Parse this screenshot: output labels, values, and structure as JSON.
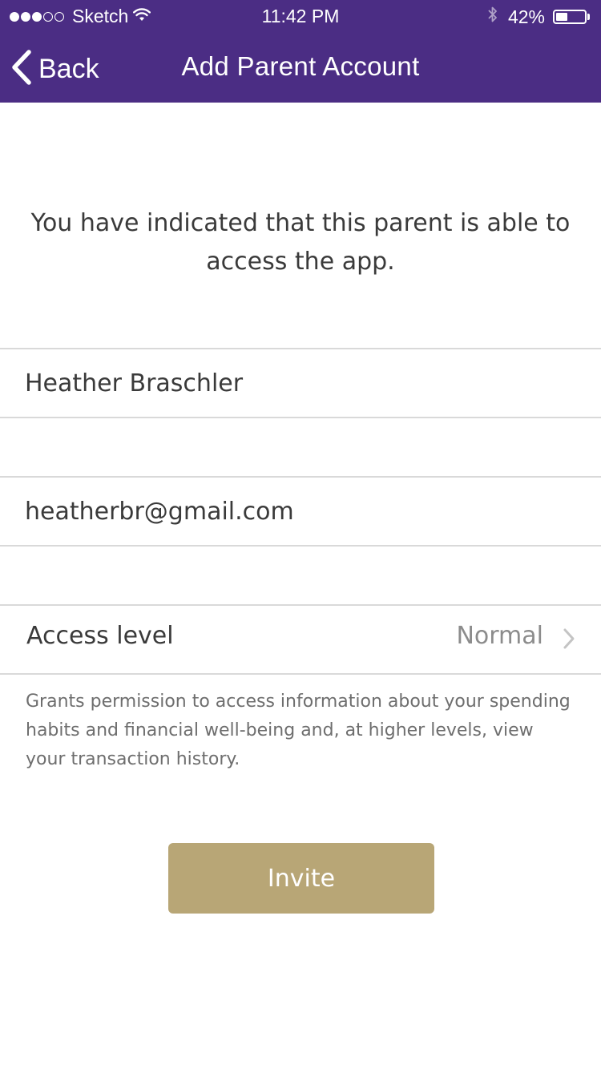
{
  "status_bar": {
    "signal_dots_filled": 3,
    "signal_dots_total": 5,
    "carrier": "Sketch",
    "time": "11:42 PM",
    "battery_percent": "42%",
    "battery_level": 0.42
  },
  "nav": {
    "back_label": "Back",
    "title": "Add Parent Account"
  },
  "intro_text": "You have indicated that this parent is able to access the app.",
  "form": {
    "name_value": "Heather Braschler",
    "email_value": "heatherbr@gmail.com",
    "access_label": "Access level",
    "access_value": "Normal",
    "access_help": "Grants permission to access information about your spending habits and financial well-being and, at higher levels, view your transaction history."
  },
  "invite_label": "Invite",
  "colors": {
    "brand_purple": "#4b2d84",
    "invite_gold": "#b8a676"
  },
  "icons": {
    "back": "chevron-left-icon",
    "disclosure": "chevron-right-icon",
    "wifi": "wifi-icon",
    "bluetooth": "bluetooth-icon",
    "battery": "battery-icon"
  }
}
